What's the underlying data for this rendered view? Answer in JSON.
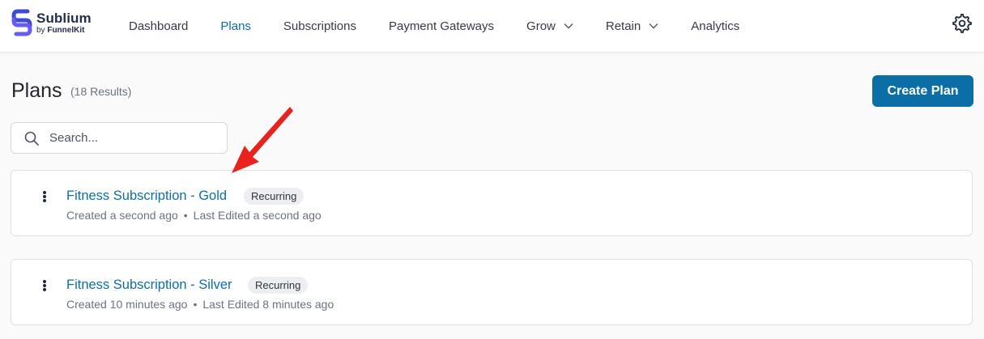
{
  "brand": {
    "name": "Sublium",
    "by": "by",
    "company": "FunnelKit"
  },
  "nav": [
    {
      "label": "Dashboard",
      "active": false,
      "dropdown": false
    },
    {
      "label": "Plans",
      "active": true,
      "dropdown": false
    },
    {
      "label": "Subscriptions",
      "active": false,
      "dropdown": false
    },
    {
      "label": "Payment Gateways",
      "active": false,
      "dropdown": false
    },
    {
      "label": "Grow",
      "active": false,
      "dropdown": true
    },
    {
      "label": "Retain",
      "active": false,
      "dropdown": true
    },
    {
      "label": "Analytics",
      "active": false,
      "dropdown": false
    }
  ],
  "page": {
    "title": "Plans",
    "results": "(18 Results)",
    "create_label": "Create Plan"
  },
  "search": {
    "placeholder": "Search...",
    "value": ""
  },
  "plans": [
    {
      "name": "Fitness Subscription - Gold",
      "badge": "Recurring",
      "created": "Created a second ago",
      "edited": "Last Edited a second ago"
    },
    {
      "name": "Fitness Subscription - Silver",
      "badge": "Recurring",
      "created": "Created 10 minutes ago",
      "edited": "Last Edited 8 minutes ago"
    }
  ],
  "meta_separator": "•",
  "colors": {
    "accent": "#0c6ea6",
    "link": "#0d6ea8",
    "annotation_arrow": "#e8221c"
  },
  "icons": {
    "settings": "gear-icon",
    "search": "search-icon",
    "menu": "kebab-menu-icon",
    "dropdown": "chevron-down-icon"
  }
}
